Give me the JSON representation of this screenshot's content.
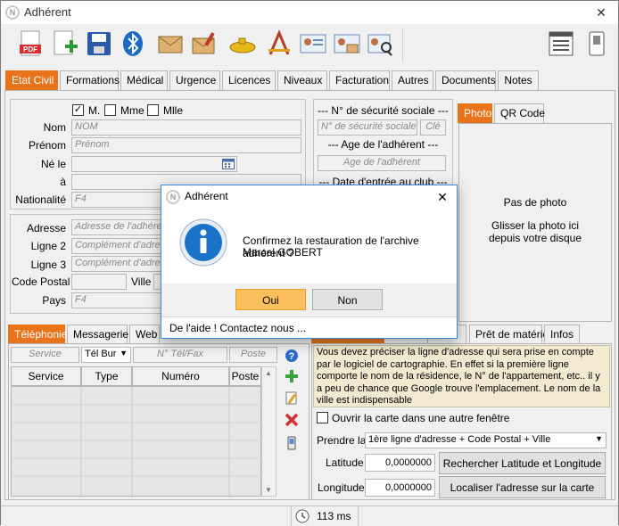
{
  "window": {
    "title": "Adhérent",
    "close_glyph": "✕"
  },
  "toolbar": {
    "icons": [
      "pdf-icon",
      "add-document-icon",
      "save-icon",
      "bluetooth-icon",
      "envelope-icon",
      "signed-envelope-icon",
      "submarine-icon",
      "drawing-tools-icon",
      "id-card-icon",
      "id-card-mail-icon",
      "id-card-search-icon"
    ]
  },
  "tabs": [
    "Etat Civil",
    "Formations",
    "Médical",
    "Urgence",
    "Licences",
    "Niveaux",
    "Facturation",
    "Autres",
    "Documents",
    "Notes"
  ],
  "etat_civil": {
    "civilite": {
      "m": "M.",
      "mme": "Mme",
      "mlle": "Mlle",
      "m_checked": "✓"
    },
    "nom": {
      "label": "Nom",
      "placeholder": "NOM"
    },
    "prenom": {
      "label": "Prénom",
      "placeholder": "Prénom"
    },
    "ne_le": {
      "label": "Né le"
    },
    "a": {
      "label": "à"
    },
    "nationalite": {
      "label": "Nationalité",
      "value": "F4"
    }
  },
  "securite": {
    "header": "--- N° de sécurité sociale ---",
    "num_placeholder": "N° de sécurité sociale",
    "cle_placeholder": "Clé",
    "age_header": "--- Age de l'adhérent ---",
    "age_placeholder": "Age de l'adhérent",
    "entree_header": "--- Date d'entrée au club ---"
  },
  "adresse": {
    "adresse": {
      "label": "Adresse",
      "placeholder": "Adresse de l'adhérent"
    },
    "ligne2": {
      "label": "Ligne 2",
      "placeholder": "Complément d'adresse"
    },
    "ligne3": {
      "label": "Ligne 3",
      "placeholder": "Complément d'adresse"
    },
    "code_postal": {
      "label": "Code Postal"
    },
    "ville": {
      "label": "Ville"
    },
    "pays": {
      "label": "Pays",
      "value": "F4"
    }
  },
  "photo": {
    "tabs": [
      "Photo",
      "QR Code"
    ],
    "no_photo": "Pas de photo",
    "hint_line1": "Glisser la photo ici",
    "hint_line2": "depuis votre disque"
  },
  "contact_tabs": [
    "Téléphonie",
    "Messagerie",
    "Web"
  ],
  "telephonie": {
    "service_placeholder": "Service",
    "type_value": "Tél Bur",
    "num_placeholder": "N° Tél/Fax",
    "poste_placeholder": "Poste",
    "columns": [
      "Service",
      "Type",
      "Numéro",
      "Poste"
    ]
  },
  "right_tabs": [
    "...es",
    "Prêt de matériel",
    "Infos"
  ],
  "carte": {
    "info": "Vous devez préciser la ligne d'adresse qui sera prise en compte par le logiciel de cartographie. En effet si la première ligne comporte le nom de la résidence, le N° de l'appartement, etc.. il y a peu de chance que Google trouve l'emplacement. Le nom de la ville est indispensable",
    "open_new_window": "Ouvrir la carte dans une autre fenêtre",
    "prendre_label": "Prendre la",
    "prendre_value": "1ère ligne d'adresse + Code Postal + Ville",
    "latitude_label": "Latitude",
    "latitude_value": "0,0000000",
    "longitude_label": "Longitude",
    "longitude_value": "0,0000000",
    "search_btn": "Rechercher Latitude et Longitude",
    "locate_btn": "Localiser l'adresse sur la carte"
  },
  "dialog": {
    "title": "Adhérent",
    "line1": "Confirmez la restauration de l'archive adhérent ?",
    "line2": "Marcel GOBERT",
    "yes": "Oui",
    "no": "Non",
    "help": "De l'aide ! Contactez nous ..."
  },
  "status": {
    "time": "113 ms"
  },
  "colors": {
    "accent": "#e8731a",
    "dialog_border": "#3a8ad8",
    "info_blue": "#1a73c8"
  }
}
